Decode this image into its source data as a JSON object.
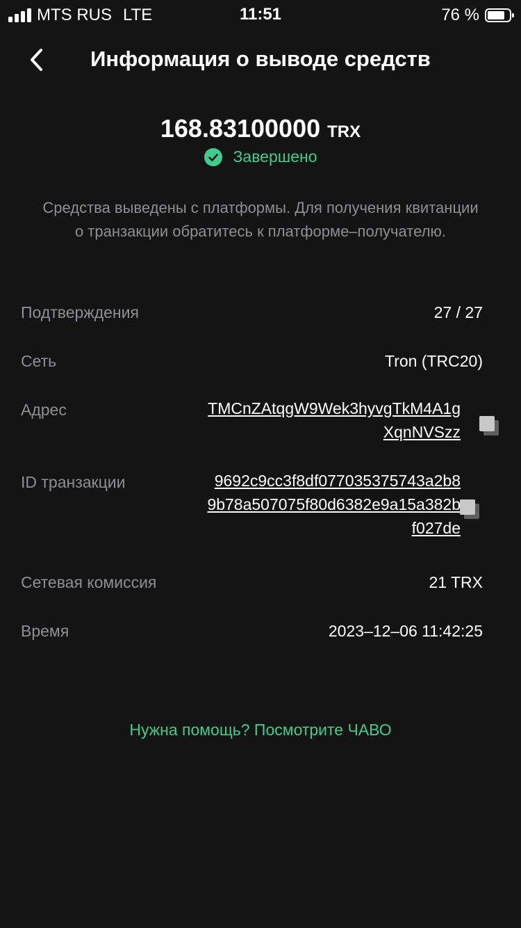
{
  "status_bar": {
    "carrier": "MTS RUS",
    "network": "LTE",
    "time": "11:51",
    "battery": "76 %"
  },
  "header": {
    "title": "Информация о выводе средств",
    "back_icon": "chevron-left-icon"
  },
  "amount": {
    "value": "168.83100000",
    "currency": "TRX"
  },
  "status": {
    "text": "Завершено",
    "color": "#3fcd8e",
    "icon": "check-circle-icon"
  },
  "description": "Средства выведены с платформы. Для получения квитанции о транзакции обратитесь к платформе–получателю.",
  "details": {
    "confirmations": {
      "label": "Подтверждения",
      "value": "27 / 27"
    },
    "network": {
      "label": "Сеть",
      "value": "Tron (TRC20)"
    },
    "address": {
      "label": "Адрес",
      "line1": "TMCnZAtqgW9Wek3hyvgTkM4A1g",
      "line2": "XqnNVSzz"
    },
    "txid": {
      "label": "ID транзакции",
      "line1": "9692c9cc3f8df077035375743a2b8",
      "line2": "9b78a507075f80d6382e9a15a382b",
      "line3": "f027de"
    },
    "fee": {
      "label": "Сетевая комиссия",
      "value": "21 TRX"
    },
    "time": {
      "label": "Время",
      "value": "2023–12–06 11:42:25"
    }
  },
  "help_link": "Нужна помощь? Посмотрите ЧАВО"
}
